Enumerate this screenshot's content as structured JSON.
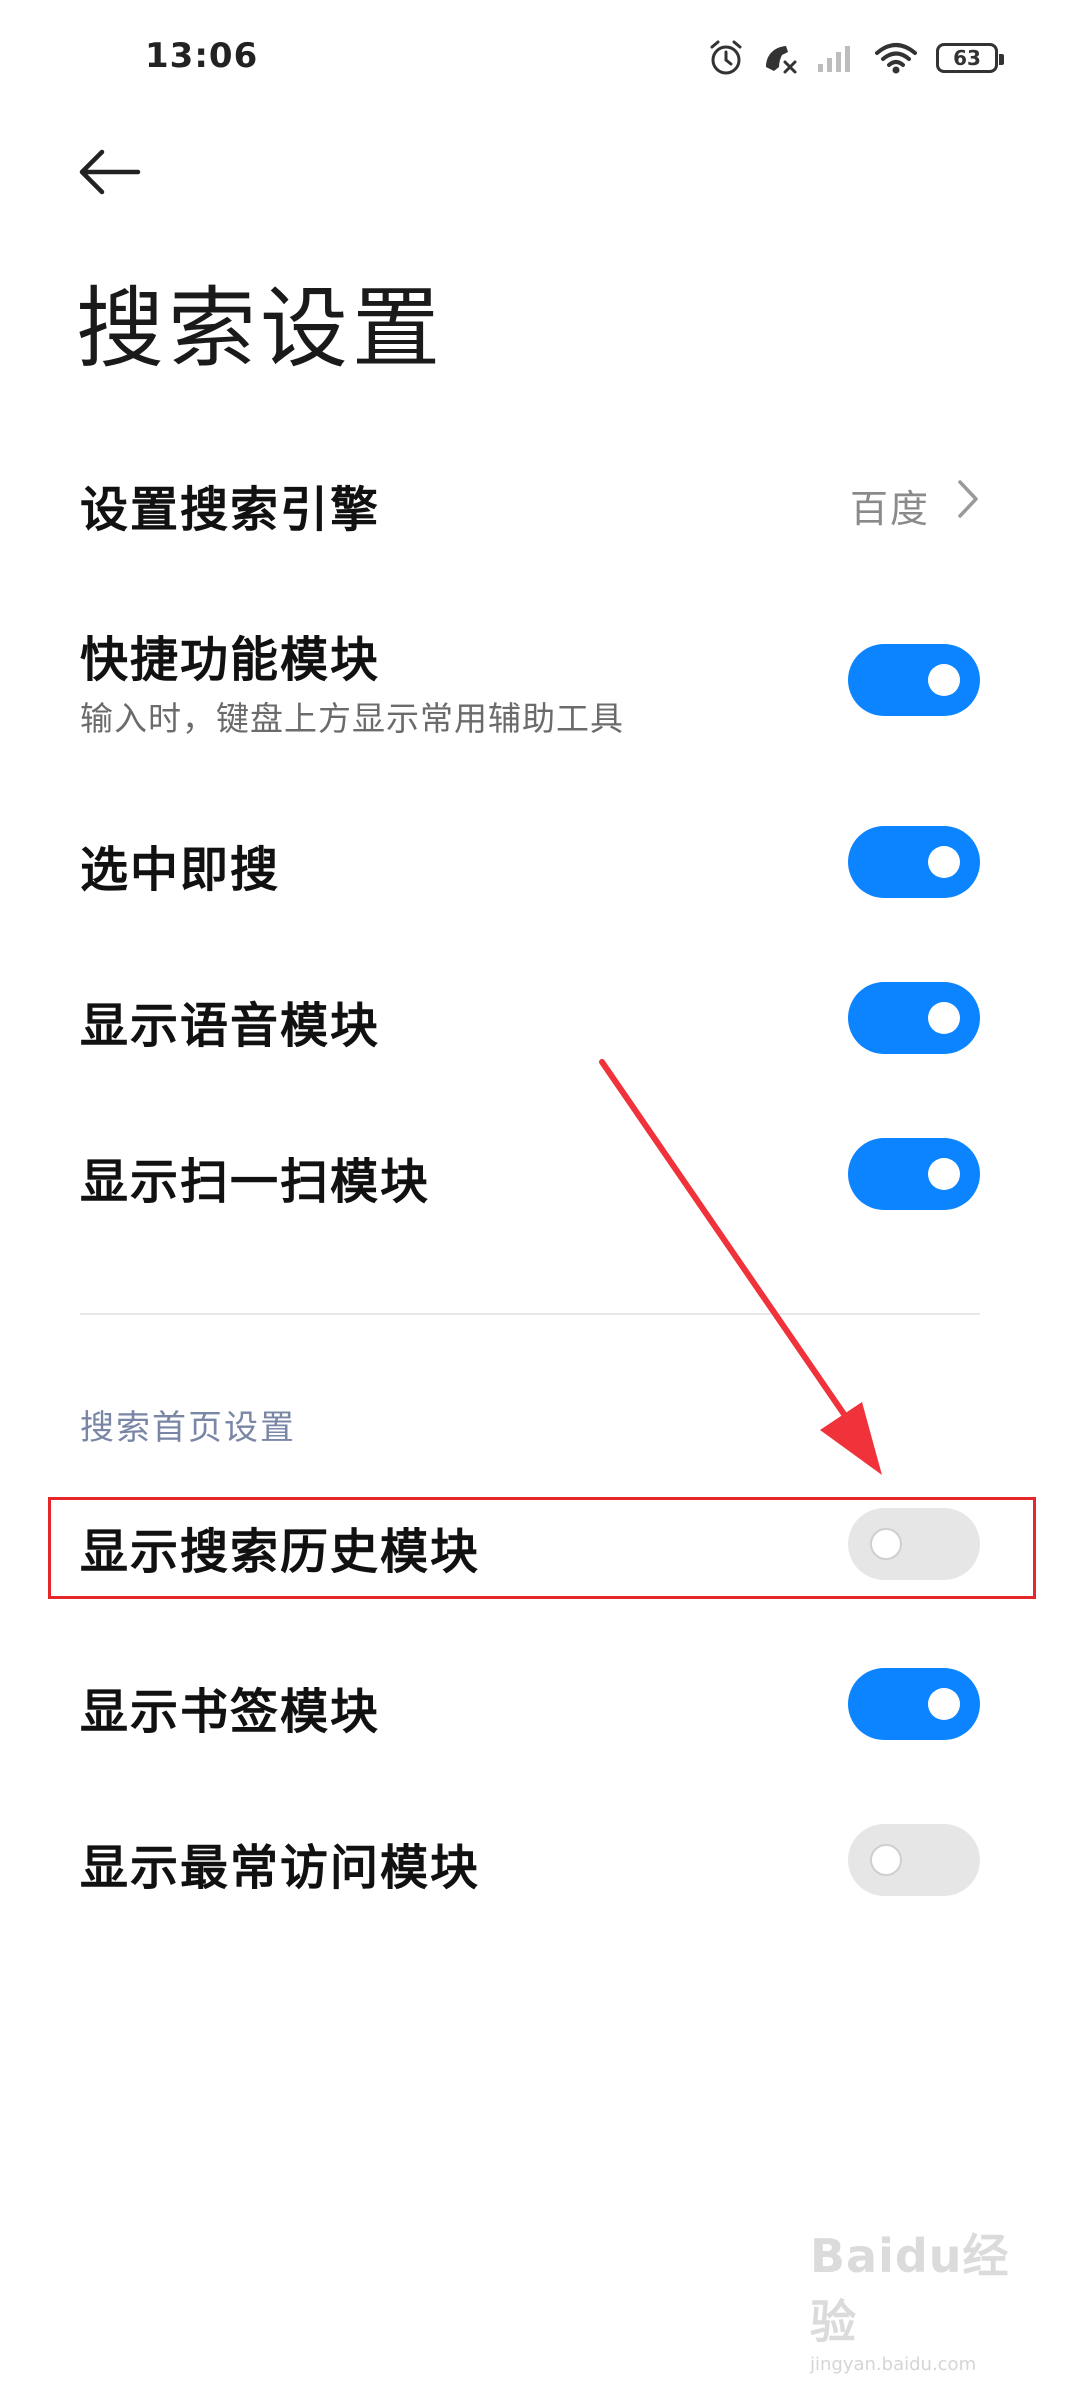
{
  "status_bar": {
    "time": "13:06",
    "battery": "63",
    "icons": [
      "alarm-icon",
      "call-missed-icon",
      "signal-icon",
      "wifi-icon",
      "battery-icon"
    ]
  },
  "page": {
    "title": "搜索设置"
  },
  "settings": [
    {
      "label": "设置搜索引擎",
      "value": "百度"
    },
    {
      "label": "快捷功能模块",
      "sub": "输入时，键盘上方显示常用辅助工具",
      "enabled": true
    },
    {
      "label": "选中即搜",
      "enabled": true
    },
    {
      "label": "显示语音模块",
      "enabled": true
    },
    {
      "label": "显示扫一扫模块",
      "enabled": true
    }
  ],
  "homepage_section": {
    "header": "搜索首页设置",
    "items": [
      {
        "label": "显示搜索历史模块",
        "enabled": false
      },
      {
        "label": "显示书签模块",
        "enabled": true
      },
      {
        "label": "显示最常访问模块",
        "enabled": false
      }
    ]
  },
  "colors": {
    "accent": "#0d84ff",
    "toggle_off": "#e6e6e6",
    "annotation": "#e5272a"
  },
  "watermark": {
    "text": "Baidu经验",
    "url": "jingyan.baidu.com"
  }
}
